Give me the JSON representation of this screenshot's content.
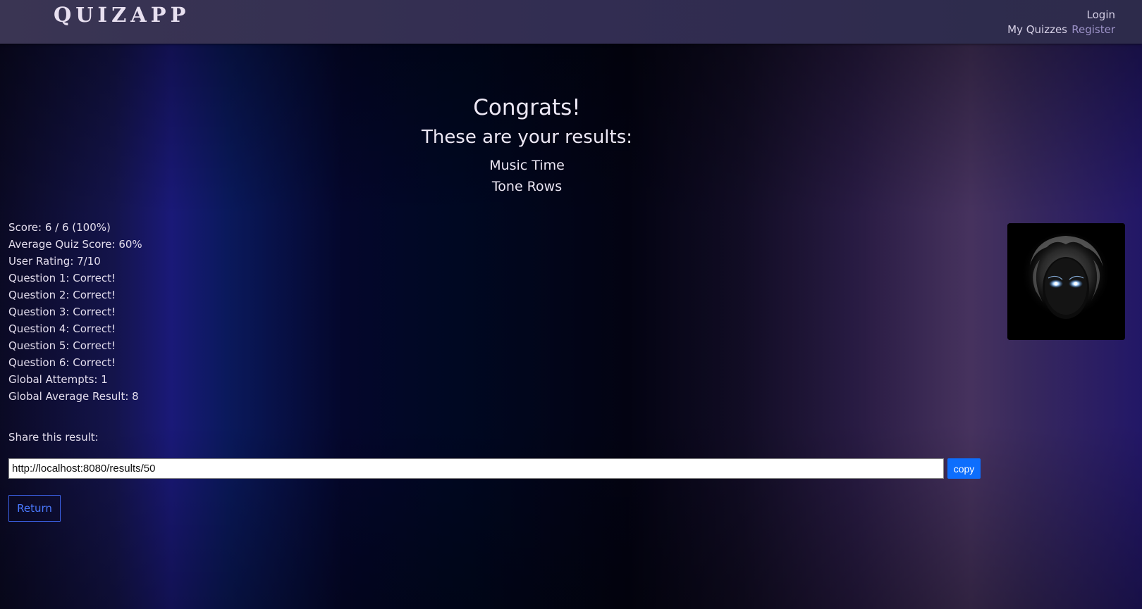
{
  "navbar": {
    "brand": "QUIZAPP",
    "login": "Login",
    "my_quizzes": "My Quizzes",
    "register": "Register"
  },
  "results": {
    "congrats": "Congrats!",
    "subtitle": "These are your results:",
    "quiz_title": "Music Time",
    "quiz_topic": "Tone Rows"
  },
  "stats": [
    "Score: 6 / 6 (100%)",
    "Average Quiz Score: 60%",
    "User Rating: 7/10",
    "Question 1: Correct!",
    "Question 2: Correct!",
    "Question 3: Correct!",
    "Question 4: Correct!",
    "Question 5: Correct!",
    "Question 6: Correct!",
    "Global Attempts: 1",
    "Global Average Result: 8"
  ],
  "share": {
    "label": "Share this result:",
    "url": "http://localhost:8080/results/50",
    "copy_label": "copy"
  },
  "return_label": "Return",
  "colors": {
    "accent_button": "#0d6efd",
    "return_outline": "#3c62e8",
    "navbar_bg": "#322d52"
  },
  "icons": {
    "quiz_image": "masked-face-image"
  }
}
